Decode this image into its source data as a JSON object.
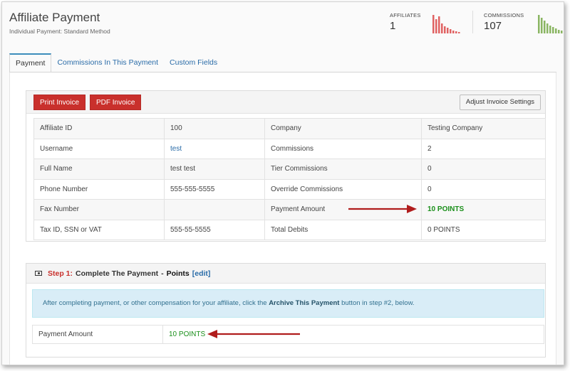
{
  "header": {
    "title": "Affiliate Payment",
    "subtitle": "Individual Payment: Standard Method"
  },
  "stats": {
    "affiliates": {
      "label": "AFFILIATES",
      "value": "1",
      "color": "#e06262"
    },
    "commissions": {
      "label": "COMMISSIONS",
      "value": "107",
      "color": "#8ab562"
    }
  },
  "tabs": [
    {
      "label": "Payment",
      "active": true
    },
    {
      "label": "Commissions In This Payment",
      "active": false
    },
    {
      "label": "Custom Fields",
      "active": false
    }
  ],
  "buttons": {
    "print_invoice": "Print Invoice",
    "pdf_invoice": "PDF Invoice",
    "adjust_invoice": "Adjust Invoice Settings"
  },
  "info_table": [
    [
      "Affiliate ID",
      "100",
      "Company",
      "Testing Company"
    ],
    [
      "Username",
      "test",
      "Commissions",
      "2"
    ],
    [
      "Full Name",
      "test test",
      "Tier Commissions",
      "0"
    ],
    [
      "Phone Number",
      "555-555-5555",
      "Override Commissions",
      "0"
    ],
    [
      "Fax Number",
      "",
      "Payment Amount",
      "10 POINTS"
    ],
    [
      "Tax ID, SSN or VAT",
      "555-55-5555",
      "Total Debits",
      "0 POINTS"
    ]
  ],
  "step": {
    "label": "Step 1:",
    "text": "Complete The Payment",
    "separator": "-",
    "type": "Points",
    "edit": "[edit]"
  },
  "callout": {
    "before": "After completing payment, or other compensation for your affiliate, click the ",
    "bold": "Archive This Payment",
    "after": " button in step #2, below."
  },
  "payment_row": {
    "label": "Payment Amount",
    "value": "10 POINTS"
  },
  "colors": {
    "accent_red": "#c9302c",
    "link_blue": "#2a6ca8",
    "points_green": "#1a8f1a",
    "arrow_red": "#b01c1c"
  }
}
